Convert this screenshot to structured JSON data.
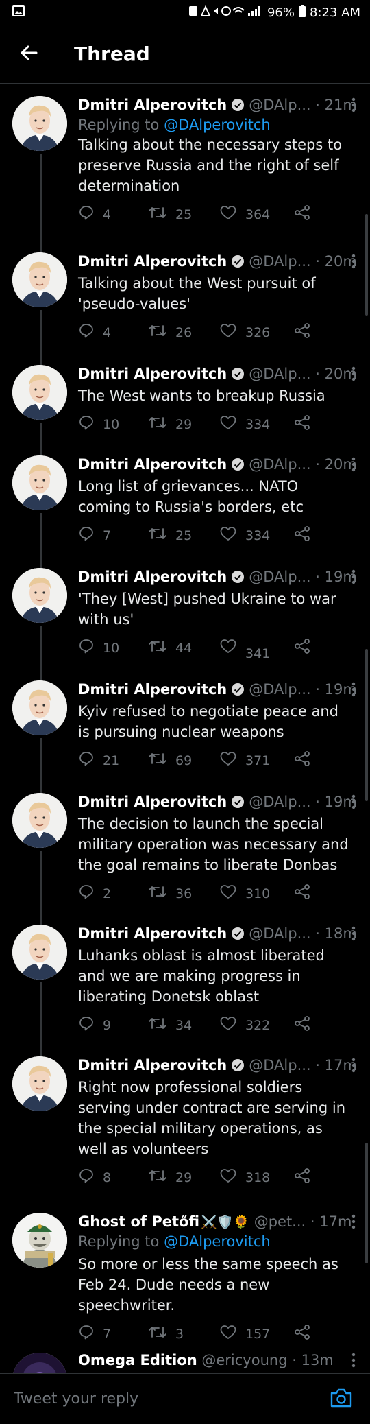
{
  "status_bar": {
    "battery": "96%",
    "time": "8:23 AM"
  },
  "header": {
    "title": "Thread"
  },
  "tweets": [
    {
      "name": "Dmitri Alperovitch",
      "handle": "@DAlp...",
      "time": "· 21m",
      "replying_prefix": "Replying to",
      "replying_to": "@DAlperovitch",
      "text": "Talking about the necessary steps to preserve Russia and the right of self determination",
      "replies": "4",
      "retweets": "25",
      "likes": "364"
    },
    {
      "name": "Dmitri Alperovitch",
      "handle": "@DAlp...",
      "time": "· 20m",
      "text": "Talking about the West pursuit of 'pseudo-values'",
      "replies": "4",
      "retweets": "26",
      "likes": "326"
    },
    {
      "name": "Dmitri Alperovitch",
      "handle": "@DAlp...",
      "time": "· 20m",
      "text": "The West wants to breakup Russia",
      "replies": "10",
      "retweets": "29",
      "likes": "334"
    },
    {
      "name": "Dmitri Alperovitch",
      "handle": "@DAlp...",
      "time": "· 20m",
      "text": "Long list of grievances... NATO coming to Russia's borders, etc",
      "replies": "7",
      "retweets": "25",
      "likes": "334"
    },
    {
      "name": "Dmitri Alperovitch",
      "handle": "@DAlp...",
      "time": "· 19m",
      "text": "'They [West] pushed Ukraine to war with us'",
      "replies": "10",
      "retweets": "44",
      "likes": "341"
    },
    {
      "name": "Dmitri Alperovitch",
      "handle": "@DAlp...",
      "time": "· 19m",
      "text": "Kyiv refused to negotiate peace and is pursuing nuclear weapons",
      "replies": "21",
      "retweets": "69",
      "likes": "371"
    },
    {
      "name": "Dmitri Alperovitch",
      "handle": "@DAlp...",
      "time": "· 19m",
      "text": "The decision to launch the special military operation was necessary and the goal remains to liberate Donbas",
      "replies": "2",
      "retweets": "36",
      "likes": "310"
    },
    {
      "name": "Dmitri Alperovitch",
      "handle": "@DAlp...",
      "time": "· 18m",
      "text": "Luhanks oblast is almost liberated and we are making progress in liberating Donetsk oblast",
      "replies": "9",
      "retweets": "34",
      "likes": "322"
    },
    {
      "name": "Dmitri Alperovitch",
      "handle": "@DAlp...",
      "time": "· 17m",
      "text": "Right now professional soldiers serving under contract are serving in the special military operations, as well as volunteers",
      "replies": "8",
      "retweets": "29",
      "likes": "318"
    },
    {
      "name": "Ghost of Petőfi",
      "name_emoji": "⚔️🛡️🌻",
      "handle": "@pet...",
      "time": "· 17m",
      "replying_prefix": "Replying to",
      "replying_to": "@DAlperovitch",
      "text": "So more or less the same speech as Feb 24. Dude needs a new speechwriter.",
      "replies": "7",
      "retweets": "3",
      "likes": "157"
    },
    {
      "name": "Omega Edition",
      "handle": "@ericyoung",
      "time": "· 13m"
    }
  ],
  "reply_bar": {
    "placeholder": "Tweet your reply"
  },
  "colors": {
    "background": "#000000",
    "accent": "#1d9bf0",
    "muted": "#71767b",
    "text": "#e7e9ea"
  }
}
